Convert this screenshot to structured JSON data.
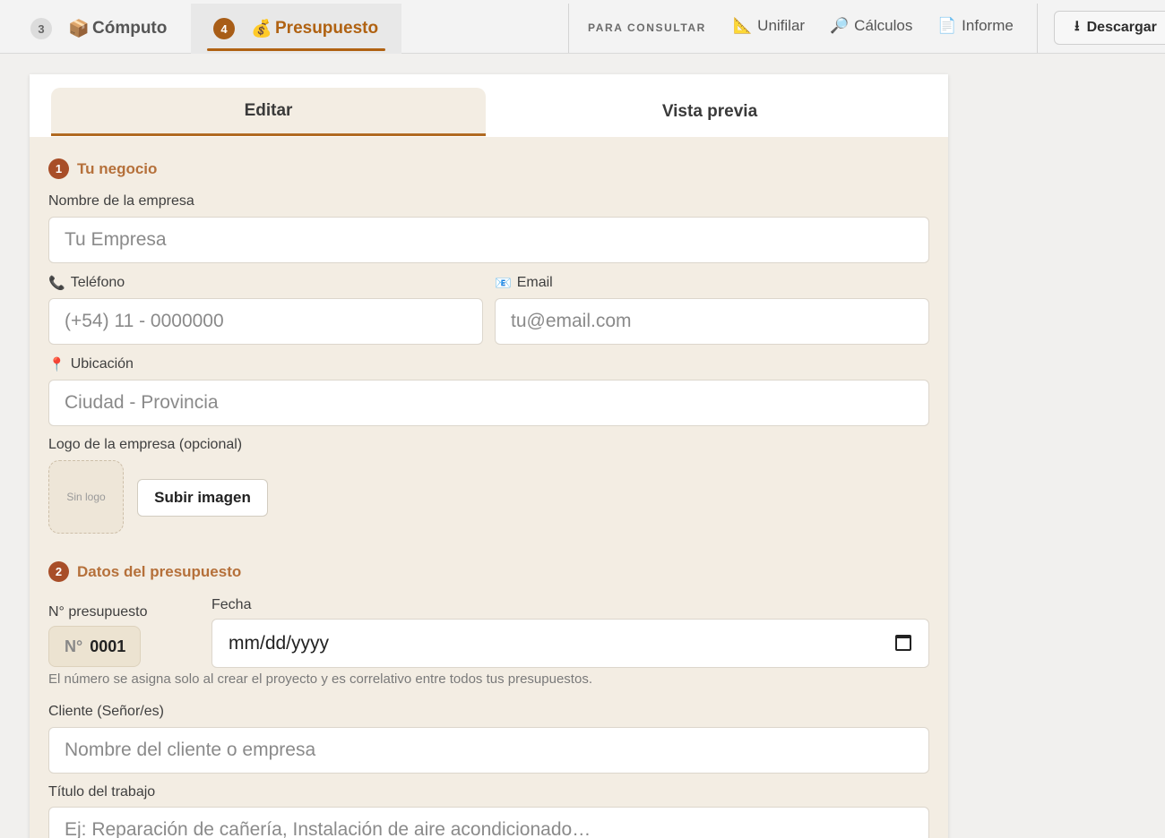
{
  "topbar": {
    "tab_compute": {
      "step": "3",
      "icon": "📦",
      "label": "Cómputo"
    },
    "tab_budget": {
      "step": "4",
      "icon": "💰",
      "label": "Presupuesto"
    },
    "consult_label": "PARA CONSULTAR",
    "links": [
      {
        "icon": "📐",
        "label": "Unifilar"
      },
      {
        "icon": "🔎",
        "label": "Cálculos"
      },
      {
        "icon": "📄",
        "label": "Informe"
      }
    ],
    "download": {
      "icon": "⭳",
      "label": "Descargar"
    }
  },
  "tabs": {
    "edit": "Editar",
    "preview": "Vista previa"
  },
  "section1": {
    "num": "1",
    "title": "Tu negocio"
  },
  "fields": {
    "company": {
      "label": "Nombre de la empresa",
      "placeholder": "Tu Empresa"
    },
    "phone": {
      "icon": "📞",
      "label": "Teléfono",
      "placeholder": "(+54) 11 - 0000000"
    },
    "email": {
      "icon": "📧",
      "label": "Email",
      "placeholder": "tu@email.com"
    },
    "location": {
      "icon": "📍",
      "label": "Ubicación",
      "placeholder": "Ciudad - Provincia"
    },
    "logo": {
      "label": "Logo de la empresa (opcional)",
      "empty_text": "Sin logo",
      "upload_button": "Subir imagen"
    }
  },
  "section2": {
    "num": "2",
    "title": "Datos del presupuesto"
  },
  "budget": {
    "number_label": "N° presupuesto",
    "number_prefix": "N°",
    "number_value": "0001",
    "date_label": "Fecha",
    "date_placeholder": "mm/dd/yyyy",
    "hint": "El número se asigna solo al crear el proyecto y es correlativo entre todos tus presupuestos.",
    "client": {
      "label": "Cliente (Señor/es)",
      "placeholder": "Nombre del cliente o empresa"
    },
    "job_title": {
      "label": "Título del trabajo",
      "placeholder": "Ej: Reparación de cañería, Instalación de aire acondicionado…"
    }
  }
}
